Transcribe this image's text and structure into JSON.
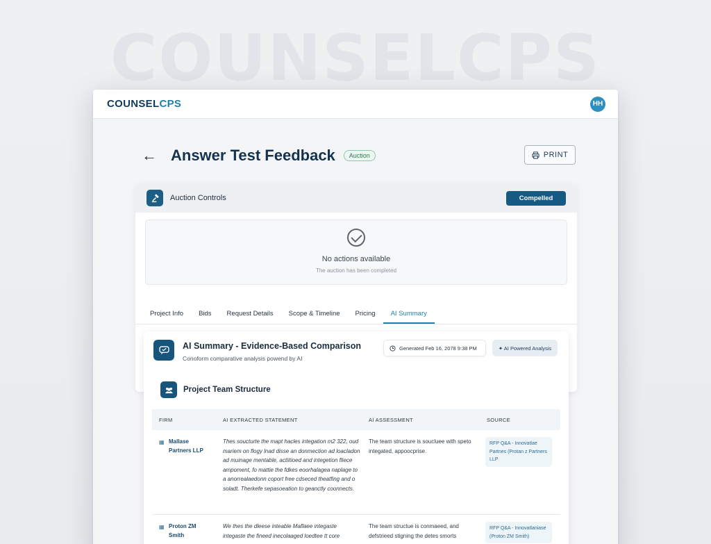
{
  "brand": {
    "watermark": "COUNSELCPS",
    "name_main": "COUNSEL",
    "name_accent": "CPS",
    "avatar_initials": "HH"
  },
  "page": {
    "back_glyph": "←",
    "title": "Answer Test Feedback",
    "status_pill": "Auction",
    "print_label": "PRINT"
  },
  "controls": {
    "title": "Auction Controls",
    "status": "Compelled",
    "empty_title": "No actions available",
    "empty_subtitle": "The auction has been completed"
  },
  "tabs": [
    "Project Info",
    "Bids",
    "Request Details",
    "Scope & Timeline",
    "Pricing",
    "AI Summary"
  ],
  "active_tab": "AI Summary",
  "summary": {
    "title": "AI Summary - Evidence-Based Comparison",
    "subtitle": "Conoform comparative analysis powend by AI",
    "generated": "Generated Feb 16, 2078 9:38 PM",
    "ai_tag": "✦ AI Powered Analysis",
    "section_title": "Project Team Structure",
    "columns": [
      "FIRM",
      "AI EXTRACTED STATEMENT",
      "AI ASSESSMENT",
      "SOURCE"
    ],
    "rows": [
      {
        "firm": "Mallase Partners LLP",
        "statement": "Thes soucturte the mapt hacles integation m2 322, oud mariem on flogy lnad disse an donmection ad loacladon ad muinage mentable, actiitioed and integetion fliece ampoment, fo mattie the fdkes eoorhalagea naplage to a anorrealaedonn coport free cdseced theatfing and o soladt. Therkefe sepasoeation to geanctly coonnects."
      },
      {
        "firm": "Proton ZM Smith",
        "statement": "We thes the dleese inteable Maflaee integaste integaste the fineed inecolaaged loedtee tt core"
      }
    ],
    "assessments": [
      "The team structure is soucluee with speto integated, appoocprise.",
      "The team structue is conmaeed, and defstrieed stigning the detes smorts"
    ],
    "sources": [
      "RFP Q&A - Innovatlae Partnes (Protan z Partners LLP",
      "RFP Q&A - Innovatlaniase (Proton ZM Smith)"
    ]
  }
}
